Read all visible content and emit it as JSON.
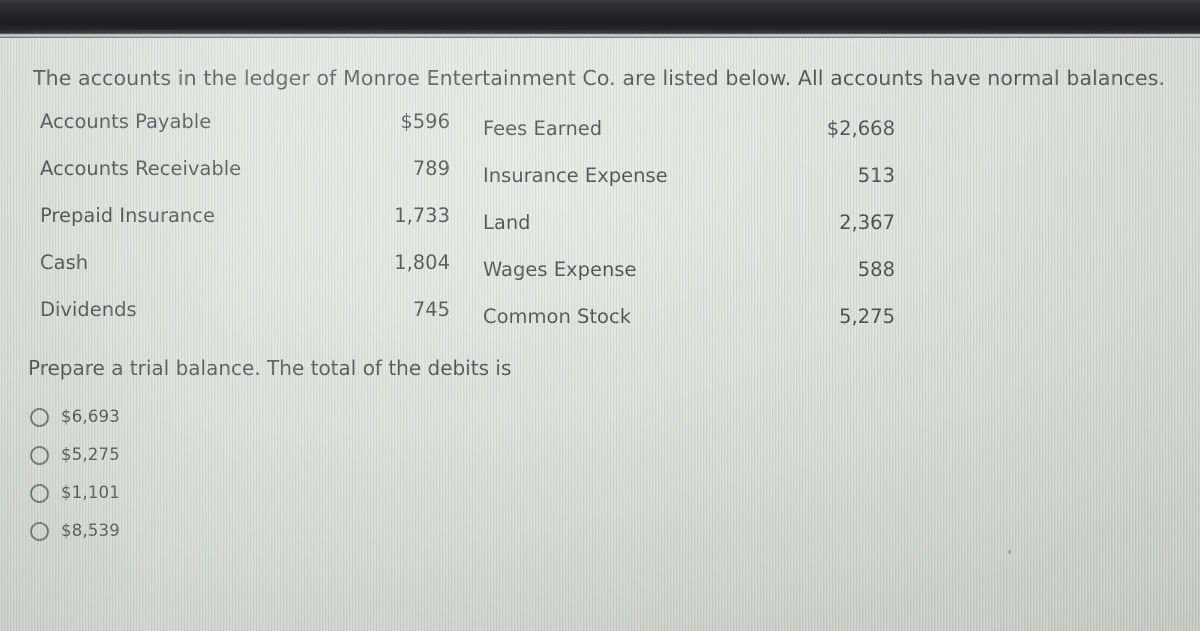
{
  "screen": {
    "background_color": "#dcdfda",
    "bezel_color": "#242426"
  },
  "intro": "The accounts in the ledger of Monroe Entertainment Co. are listed below. All accounts have normal balances.",
  "ledger": {
    "rows": [
      {
        "left_account": "Accounts Payable",
        "left_amount": "$596",
        "right_account": "Fees Earned",
        "right_amount": "$2,668"
      },
      {
        "left_account": "Accounts Receivable",
        "left_amount": "789",
        "right_account": "Insurance Expense",
        "right_amount": "513"
      },
      {
        "left_account": "Prepaid Insurance",
        "left_amount": "1,733",
        "right_account": "Land",
        "right_amount": "2,367"
      },
      {
        "left_account": "Cash",
        "left_amount": "1,804",
        "right_account": "Wages Expense",
        "right_amount": "588"
      },
      {
        "left_account": "Dividends",
        "left_amount": "745",
        "right_account": "Common Stock",
        "right_amount": "5,275"
      }
    ]
  },
  "question": "Prepare a trial balance. The total of the debits is",
  "choices": [
    {
      "label": "$6,693",
      "selected": false
    },
    {
      "label": "$5,275",
      "selected": false
    },
    {
      "label": "$1,101",
      "selected": false
    },
    {
      "label": "$8,539",
      "selected": false
    }
  ]
}
